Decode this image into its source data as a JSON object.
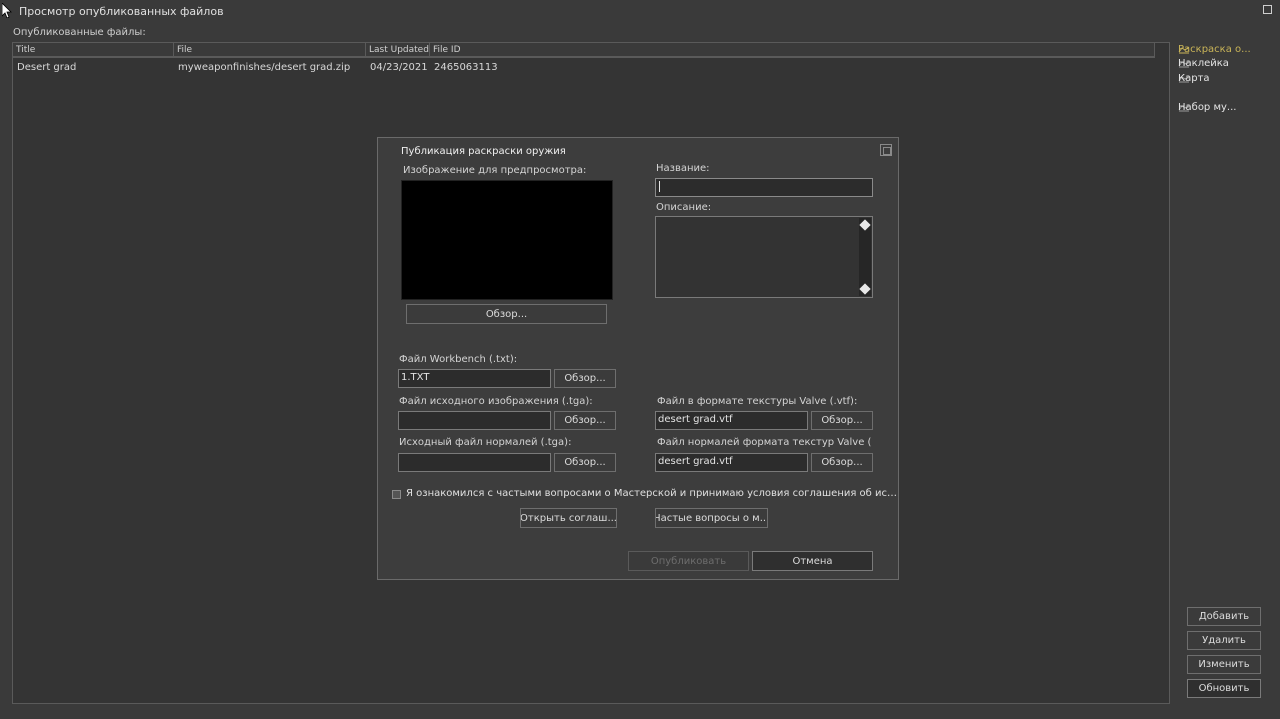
{
  "window": {
    "title": "Просмотр опубликованных файлов"
  },
  "list": {
    "label": "Опубликованные файлы:",
    "columns": [
      "Title",
      "File",
      "Last Updated",
      "File ID"
    ],
    "rows": [
      {
        "title": "Desert grad",
        "file": "myweaponfinishes/desert grad.zip",
        "updated": "04/23/2021",
        "id": "2465063113"
      }
    ]
  },
  "sidebar": {
    "items": [
      {
        "label": "Раскраска о...",
        "icon": "workshop-icon",
        "active": true
      },
      {
        "label": "Наклейка",
        "icon": "workshop-icon"
      },
      {
        "label": "Карта",
        "icon": "workshop-icon"
      },
      {
        "label": "Набор му...",
        "icon": "workshop-icon"
      }
    ],
    "buttons": {
      "add": "Добавить",
      "delete": "Удалить",
      "edit": "Изменить",
      "refresh": "Обновить"
    }
  },
  "dialog": {
    "title": "Публикация раскраски оружия",
    "preview_label": "Изображение для предпросмотра:",
    "browse": "Обзор...",
    "name_label": "Название:",
    "name_value": "",
    "desc_label": "Описание:",
    "workbench_label": "Файл Workbench (.txt):",
    "workbench_value": "1.TXT",
    "source_image_label": "Файл исходного изображения (.tga):",
    "source_image_value": "",
    "source_normal_label": "Исходный файл нормалей (.tga):",
    "source_normal_value": "",
    "vtf_label": "Файл в формате текстуры Valve (.vtf):",
    "vtf_value": "desert grad.vtf",
    "vtf_normal_label": "Файл нормалей формата текстур Valve (.v",
    "vtf_normal_value": "desert grad.vtf",
    "agree_text": "Я ознакомился с частыми вопросами о Мастерской и принимаю условия соглашения об использовани...",
    "open_agreement": "Открыть соглаш...",
    "faq": "Частые вопросы о м...",
    "publish": "Опубликовать",
    "cancel": "Отмена"
  }
}
